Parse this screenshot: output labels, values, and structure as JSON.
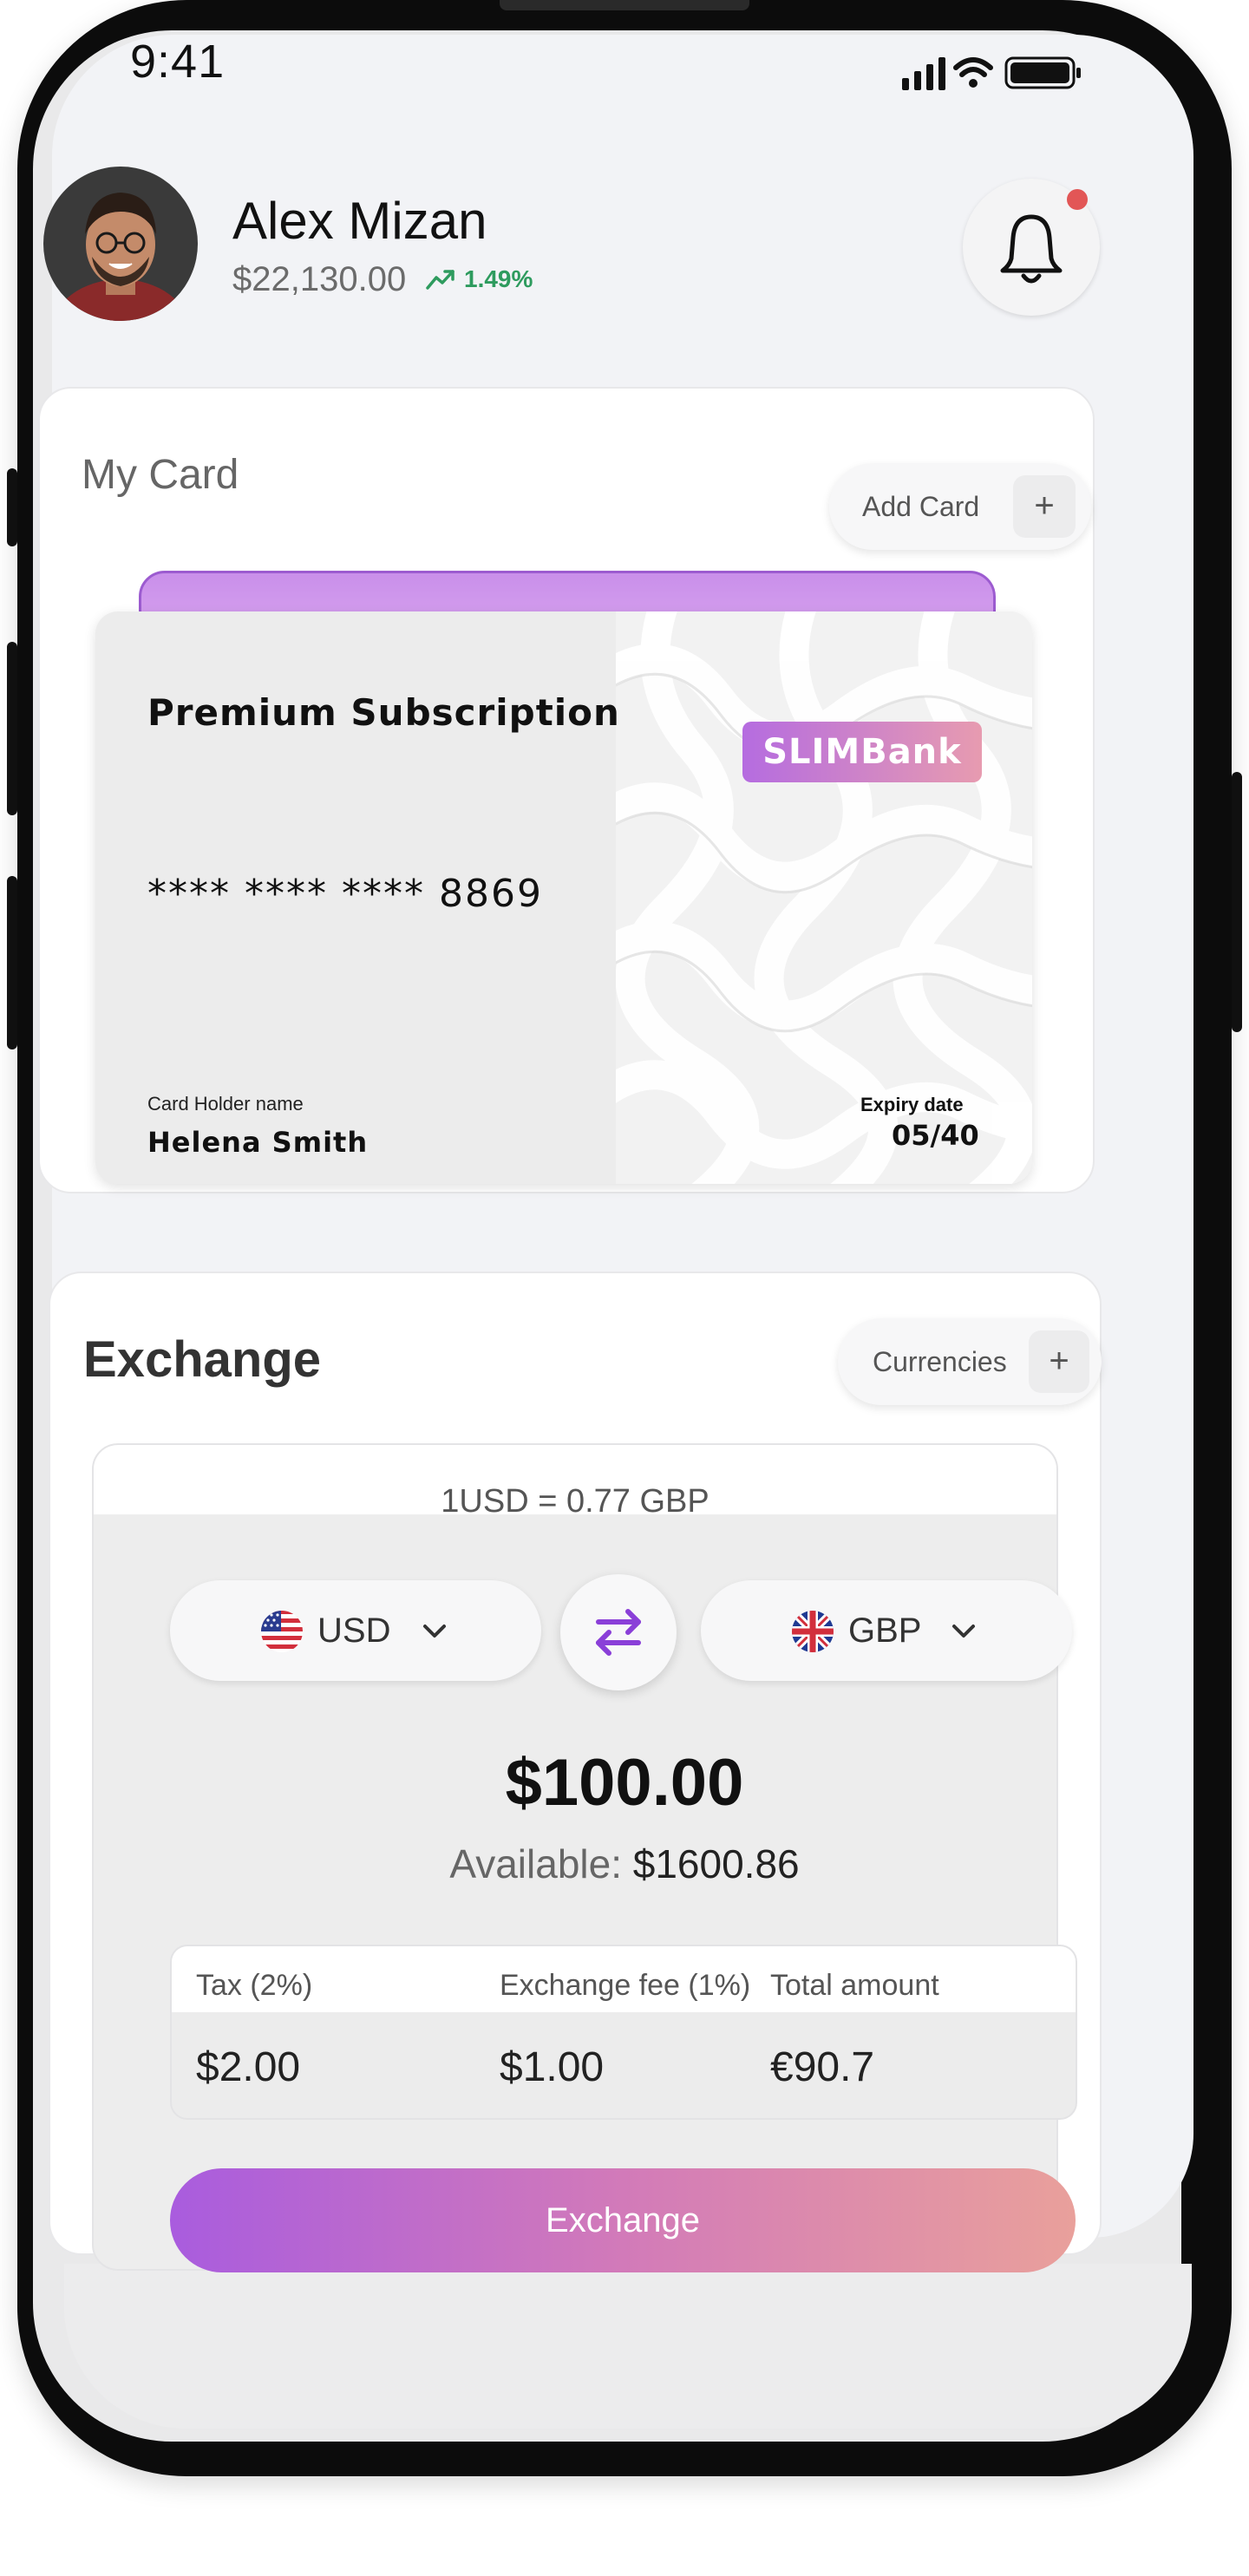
{
  "status_bar": {
    "time": "9:41"
  },
  "header": {
    "user_name": "Alex Mizan",
    "balance": "$22,130.00",
    "trend_percent": "1.49%",
    "trend_color": "#2e9b5e",
    "notification_dot_color": "#e25656"
  },
  "my_card": {
    "title": "My Card",
    "add_card_label": "Add Card",
    "add_icon": "plus-icon",
    "card": {
      "title": "Premium Subscription",
      "number": "**** **** **** 8869",
      "bank": "SLIMBank",
      "holder_label": "Card Holder name",
      "holder_name": "Helena Smith",
      "expiry_label": "Expiry date",
      "expiry": "05/40"
    }
  },
  "exchange": {
    "title": "Exchange",
    "currencies_label": "Currencies",
    "rate": "1USD = 0.77 GBP",
    "from_currency": "USD",
    "to_currency": "GBP",
    "swap_icon": "swap-arrows-icon",
    "amount": "$100.00",
    "available_label": "Available:",
    "available_value": "$1600.86",
    "fees": [
      {
        "label": "Tax (2%)",
        "value": "$2.00"
      },
      {
        "label": "Exchange fee (1%)",
        "value": "$1.00"
      },
      {
        "label": "Total amount",
        "value": "€90.7"
      }
    ],
    "button_label": "Exchange",
    "accent_color": "#8a3fd8"
  }
}
